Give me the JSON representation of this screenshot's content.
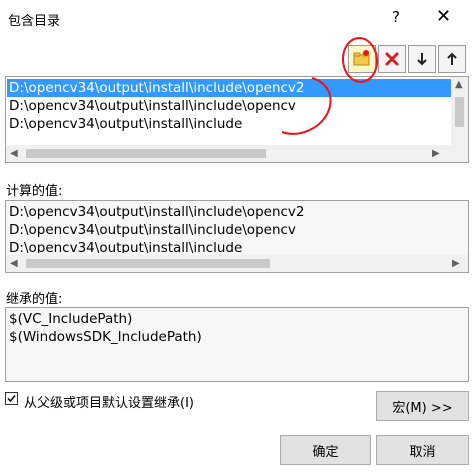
{
  "window": {
    "title": "包含目录",
    "help": "?",
    "close": "✕"
  },
  "toolbar": {
    "new_folder_icon": "new-folder-icon",
    "delete_icon": "delete-x-icon",
    "down_icon": "arrow-down-icon",
    "up_icon": "arrow-up-icon"
  },
  "directories": {
    "rows": [
      "D:\\opencv34\\output\\install\\include\\opencv2",
      "D:\\opencv34\\output\\install\\include\\opencv",
      "D:\\opencv34\\output\\install\\include"
    ],
    "selected_index": 0
  },
  "computed": {
    "label": "计算的值:",
    "rows": [
      "D:\\opencv34\\output\\install\\include\\opencv2",
      "D:\\opencv34\\output\\install\\include\\opencv",
      "D:\\opencv34\\output\\install\\include"
    ]
  },
  "inherited": {
    "label": "继承的值:",
    "rows": [
      "$(VC_IncludePath)",
      "$(WindowsSDK_IncludePath)"
    ]
  },
  "inherit_checkbox": {
    "label": "从父级或项目默认设置继承(I)",
    "checked": true
  },
  "buttons": {
    "macros": "宏(M) >>",
    "ok": "确定",
    "cancel": "取消"
  },
  "colors": {
    "selection": "#3399ff",
    "annotation_red": "#e8141e"
  }
}
